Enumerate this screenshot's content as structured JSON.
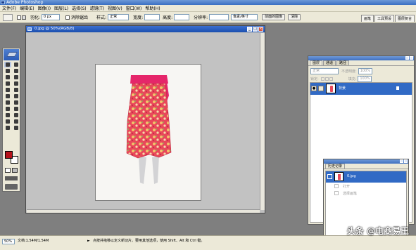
{
  "app": {
    "title": "Adobe Photoshop"
  },
  "menu": [
    "文件(F)",
    "编辑(E)",
    "图像(I)",
    "图层(L)",
    "选择(S)",
    "滤镜(T)",
    "视图(V)",
    "窗口(W)",
    "帮助(H)"
  ],
  "options": {
    "feather_label": "羽化:",
    "feather_value": "0 px",
    "antialias_label": "消除锯齿",
    "style_label": "样式:",
    "style_value": "正常",
    "width_label": "宽度:",
    "height_label": "高度:",
    "resolution_label": "分辨率:",
    "unit_value": "像素/英寸",
    "front_image_button": "前面的图像",
    "clear_button": "清除"
  },
  "palette_well": [
    "画笔",
    "工具预设",
    "图层复合"
  ],
  "document": {
    "title": "0.jpg @ 50%(RGB/8)",
    "image_label": "red-floral-skirt-photo"
  },
  "layers_panel": {
    "tabs": [
      "图层",
      "通道",
      "路径"
    ],
    "blend_mode": "正常",
    "opacity_label": "不透明度:",
    "opacity_value": "100%",
    "lock_label": "锁定:",
    "fill_label": "填充:",
    "fill_value": "100%",
    "layer_name": "背景",
    "accent": "#316ac5"
  },
  "history_panel": {
    "tabs": [
      "历史记录"
    ],
    "snapshot_name": "0.jpg",
    "states": [
      "打开",
      "选择画笔"
    ]
  },
  "status": {
    "zoom": "50%",
    "doc_info": "文档:1.54M/1.54M",
    "hint": "点按并拖移以定义新切片。要用其他选项，使用 Shift、Alt 和 Ctrl 键。"
  },
  "watermark": "头条 @电商易王",
  "colors": {
    "foreground": "#b5121b",
    "background": "#ffffff",
    "skirt": "#e8485a",
    "sash": "#e5266a"
  }
}
